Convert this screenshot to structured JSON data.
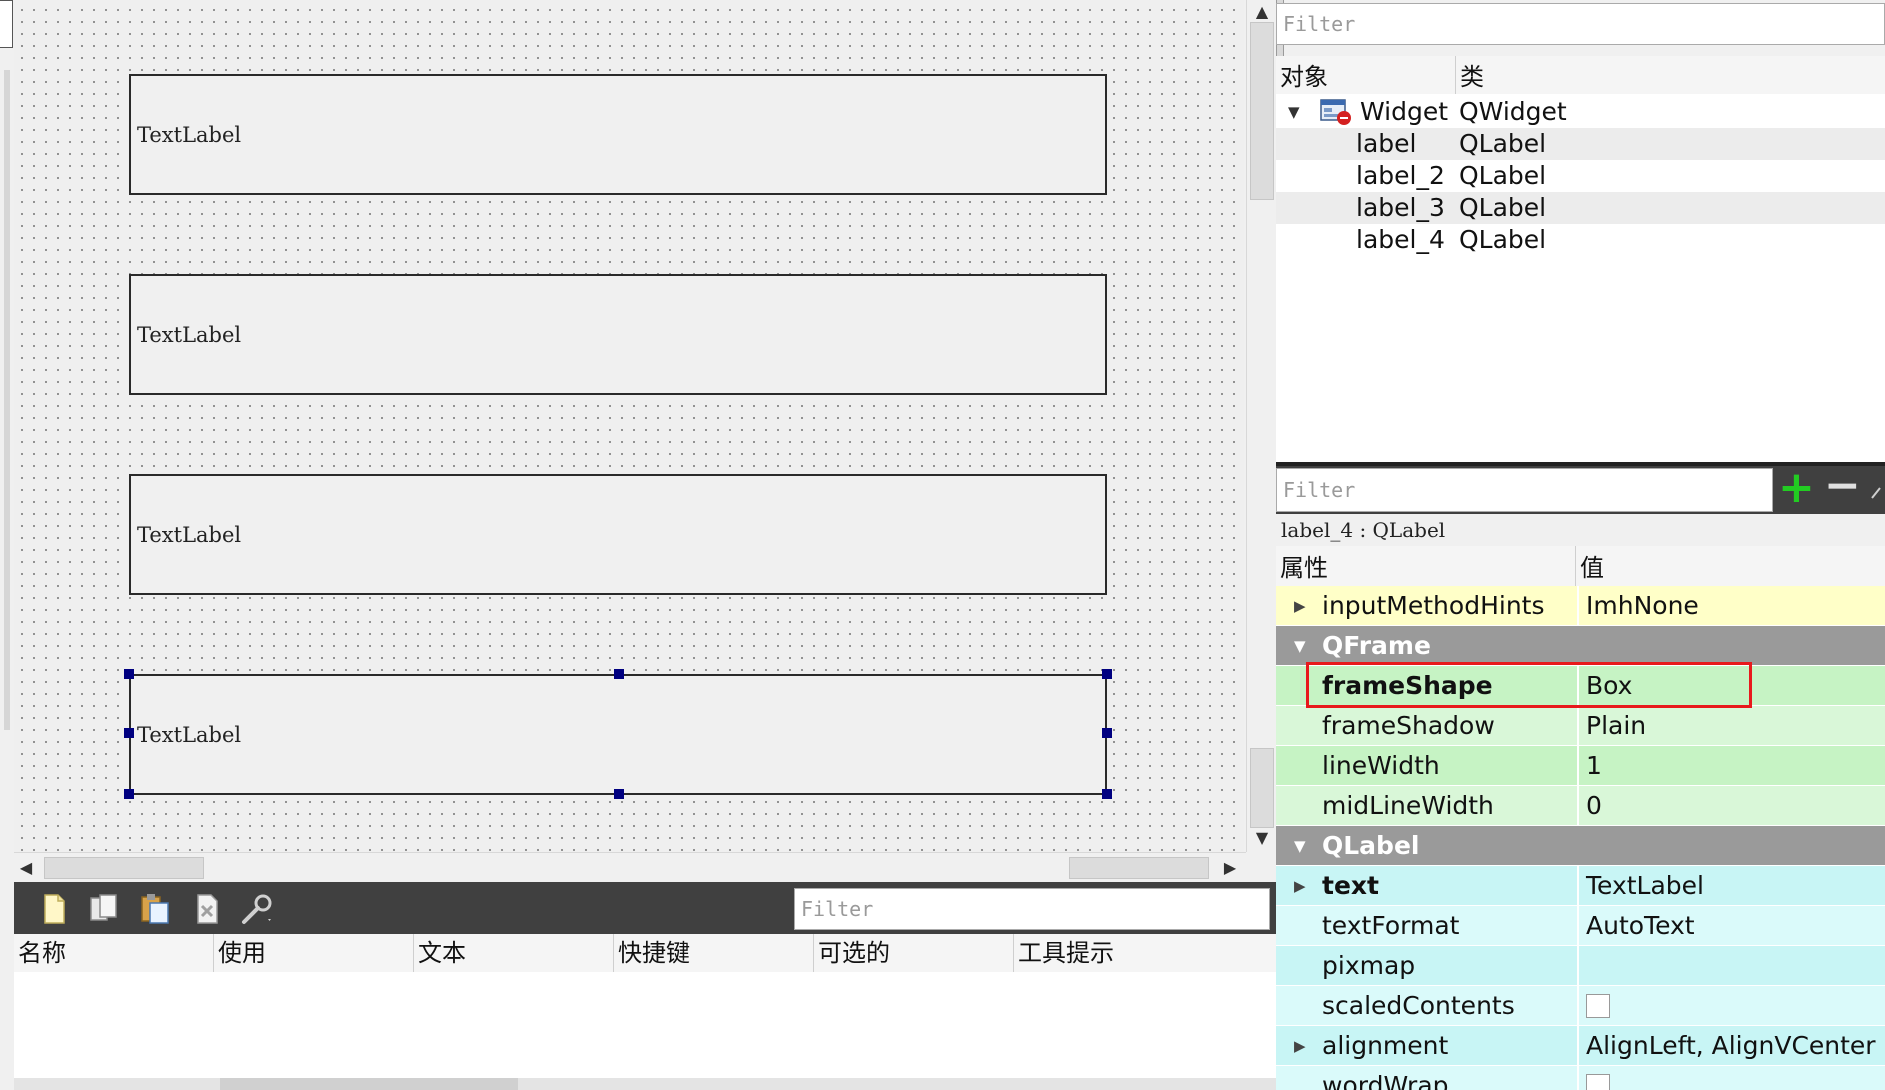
{
  "form": {
    "labels": [
      {
        "text": "TextLabel"
      },
      {
        "text": "TextLabel"
      },
      {
        "text": "TextLabel"
      },
      {
        "text": "TextLabel"
      }
    ]
  },
  "action_editor": {
    "filter_placeholder": "Filter",
    "columns": [
      "名称",
      "使用",
      "文本",
      "快捷键",
      "可选的",
      "工具提示"
    ],
    "toolbar_icons": [
      "new-action-icon",
      "copy-action-icon",
      "paste-action-icon",
      "delete-action-icon",
      "settings-wrench-icon"
    ]
  },
  "object_inspector": {
    "filter_placeholder": "Filter",
    "columns": [
      "对象",
      "类"
    ],
    "rows": [
      {
        "name": "Widget",
        "class": "QWidget"
      },
      {
        "name": "label",
        "class": "QLabel"
      },
      {
        "name": "label_2",
        "class": "QLabel"
      },
      {
        "name": "label_3",
        "class": "QLabel"
      },
      {
        "name": "label_4",
        "class": "QLabel"
      }
    ]
  },
  "property_editor": {
    "filter_placeholder": "Filter",
    "add_glyph": "+",
    "remove_glyph": "−",
    "selected_object": "label_4 : QLabel",
    "columns": [
      "属性",
      "值"
    ],
    "rows": [
      {
        "name": "inputMethodHints",
        "value": "ImhNone"
      },
      {
        "name": "QFrame"
      },
      {
        "name": "frameShape",
        "value": "Box"
      },
      {
        "name": "frameShadow",
        "value": "Plain"
      },
      {
        "name": "lineWidth",
        "value": "1"
      },
      {
        "name": "midLineWidth",
        "value": "0"
      },
      {
        "name": "QLabel"
      },
      {
        "name": "text",
        "value": "TextLabel"
      },
      {
        "name": "textFormat",
        "value": "AutoText"
      },
      {
        "name": "pixmap",
        "value": ""
      },
      {
        "name": "scaledContents"
      },
      {
        "name": "alignment",
        "value": "AlignLeft, AlignVCenter"
      },
      {
        "name": "wordWrap"
      }
    ]
  },
  "colors": {
    "yellow_row": "#ffffc8",
    "green_row": "#c6f3c4",
    "green_row_alt": "#d9f7d8",
    "cyan_row": "#c8f5f5",
    "cyan_row_alt": "#dafafa",
    "group_row": "#9a9a9a",
    "highlight_box": "#e8191c",
    "selection_handle": "#000080"
  }
}
